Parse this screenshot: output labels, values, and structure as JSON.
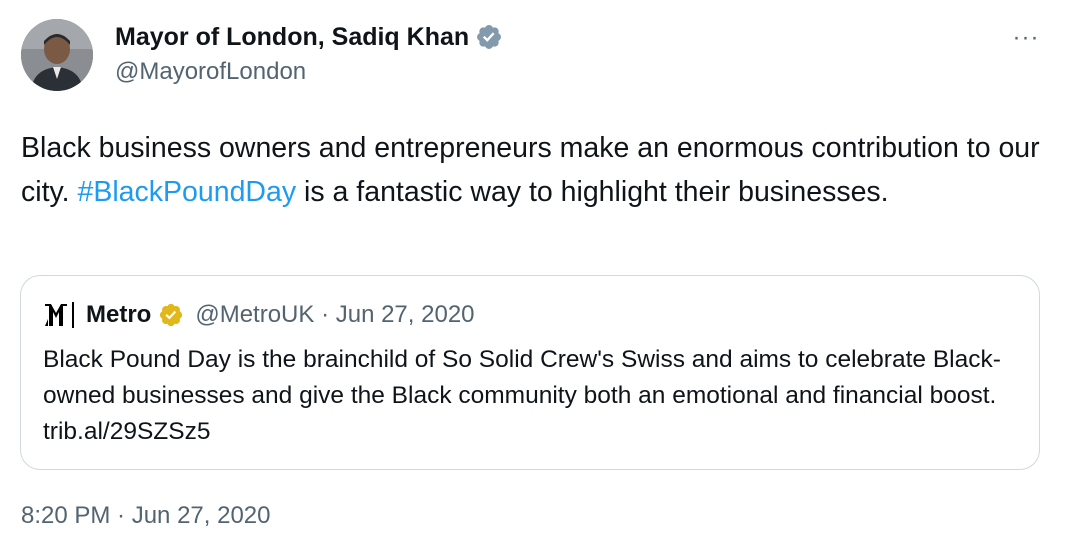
{
  "author": {
    "display_name": "Mayor of London, Sadiq Khan",
    "handle": "@MayorofLondon",
    "avatar_icon": "profile-photo",
    "verified_icon": "verified-gray-badge-icon"
  },
  "tweet": {
    "text_before": "Black business owners and entrepreneurs make an enormous contribution to our city. ",
    "hashtag": "#BlackPoundDay",
    "text_after": " is a fantastic way to highlight their businesses.",
    "timestamp": "8:20 PM · Jun 27, 2020"
  },
  "quote": {
    "logo_icon": "metro-logo-icon",
    "name": "Metro",
    "verified_icon": "verified-gold-badge-icon",
    "meta": "@MetroUK · Jun 27, 2020",
    "text": "Black Pound Day is the brainchild of So Solid Crew's Swiss and aims to celebrate Black-owned businesses and give the Black community both an emotional and financial boost. trib.al/29SZSz5"
  },
  "menu": {
    "more_label": "···",
    "icon": "more-horizontal-icon"
  },
  "colors": {
    "text": "#0f1419",
    "secondary": "#536471",
    "link": "#1d9bf0",
    "border": "#cfd9de",
    "gray_badge": "#829aab",
    "gold_badge": "#e2b719"
  }
}
